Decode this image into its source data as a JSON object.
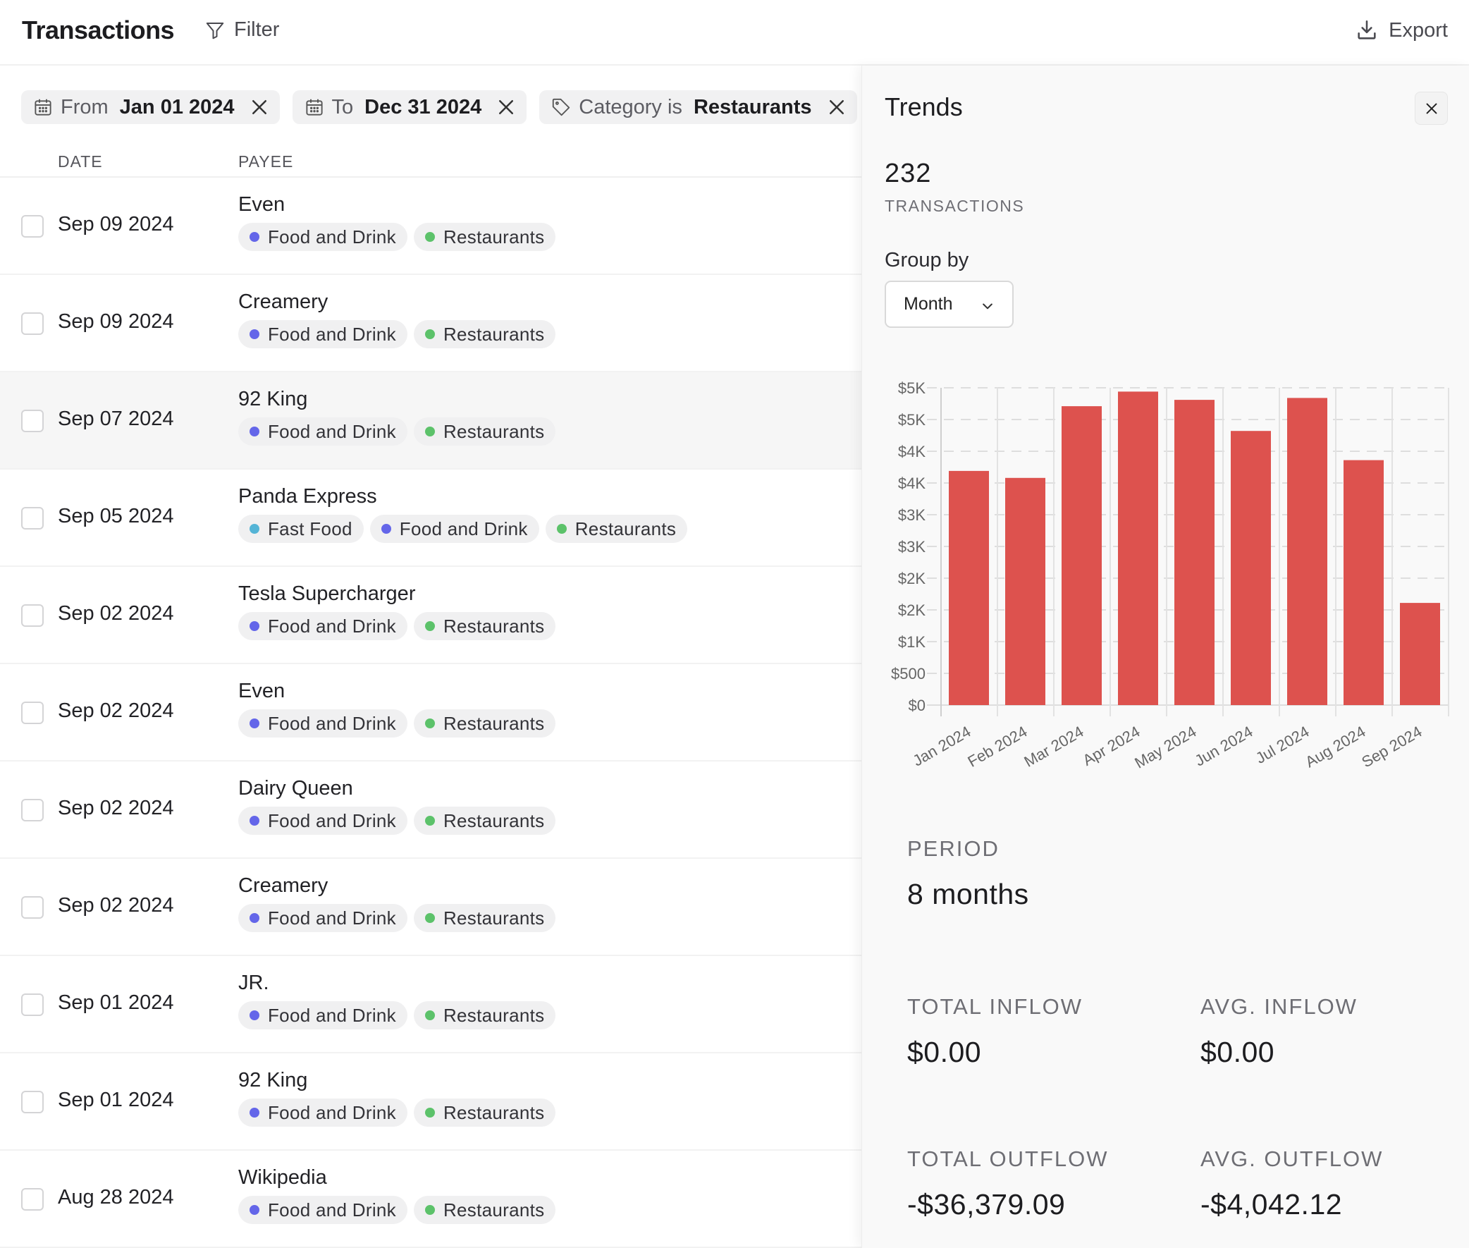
{
  "header": {
    "title": "Transactions",
    "filter_label": "Filter",
    "export_label": "Export"
  },
  "filters": [
    {
      "prefix": "From",
      "value": "Jan 01 2024",
      "icon": "calendar-icon"
    },
    {
      "prefix": "To",
      "value": "Dec 31 2024",
      "icon": "calendar-icon"
    },
    {
      "prefix": "Category is",
      "value": "Restaurants",
      "icon": "tag-icon"
    }
  ],
  "columns": {
    "date": "DATE",
    "payee": "PAYEE"
  },
  "tag_colors": {
    "Food and Drink": "#6466e9",
    "Restaurants": "#5cc26a",
    "Fast Food": "#54b4d6"
  },
  "transactions": [
    {
      "date": "Sep 09 2024",
      "payee": "Even",
      "tags": [
        "Food and Drink",
        "Restaurants"
      ]
    },
    {
      "date": "Sep 09 2024",
      "payee": "Creamery",
      "tags": [
        "Food and Drink",
        "Restaurants"
      ]
    },
    {
      "date": "Sep 07 2024",
      "payee": "92 King",
      "tags": [
        "Food and Drink",
        "Restaurants"
      ],
      "hovered": true
    },
    {
      "date": "Sep 05 2024",
      "payee": "Panda Express",
      "tags": [
        "Fast Food",
        "Food and Drink",
        "Restaurants"
      ]
    },
    {
      "date": "Sep 02 2024",
      "payee": "Tesla Supercharger",
      "tags": [
        "Food and Drink",
        "Restaurants"
      ]
    },
    {
      "date": "Sep 02 2024",
      "payee": "Even",
      "tags": [
        "Food and Drink",
        "Restaurants"
      ]
    },
    {
      "date": "Sep 02 2024",
      "payee": "Dairy Queen",
      "tags": [
        "Food and Drink",
        "Restaurants"
      ]
    },
    {
      "date": "Sep 02 2024",
      "payee": "Creamery",
      "tags": [
        "Food and Drink",
        "Restaurants"
      ]
    },
    {
      "date": "Sep 01 2024",
      "payee": "JR.",
      "tags": [
        "Food and Drink",
        "Restaurants"
      ]
    },
    {
      "date": "Sep 01 2024",
      "payee": "92 King",
      "tags": [
        "Food and Drink",
        "Restaurants"
      ]
    },
    {
      "date": "Aug 28 2024",
      "payee": "Wikipedia",
      "tags": [
        "Food and Drink",
        "Restaurants"
      ]
    }
  ],
  "trends": {
    "title": "Trends",
    "count": "232",
    "count_label": "TRANSACTIONS",
    "group_by_label": "Group by",
    "group_by_value": "Month",
    "period_label": "PERIOD",
    "period_value": "8 months",
    "total_inflow_label": "TOTAL INFLOW",
    "total_inflow_value": "$0.00",
    "avg_inflow_label": "AVG. INFLOW",
    "avg_inflow_value": "$0.00",
    "total_outflow_label": "TOTAL OUTFLOW",
    "total_outflow_value": "-$36,379.09",
    "avg_outflow_label": "AVG. OUTFLOW",
    "avg_outflow_value": "-$4,042.12"
  },
  "chart_data": {
    "type": "bar",
    "title": "",
    "xlabel": "",
    "ylabel": "",
    "categories": [
      "Jan 2024",
      "Feb 2024",
      "Mar 2024",
      "Apr 2024",
      "May 2024",
      "Jun 2024",
      "Jul 2024",
      "Aug 2024",
      "Sep 2024"
    ],
    "values": [
      3690,
      3580,
      4710,
      4940,
      4810,
      4320,
      4840,
      3860,
      1610
    ],
    "ylim": [
      0,
      5000
    ],
    "yticks": [
      0,
      500,
      1000,
      1500,
      2000,
      2500,
      3000,
      3500,
      4000,
      4500,
      5000
    ],
    "ytick_labels": [
      "$0",
      "$500",
      "$1K",
      "$2K",
      "$2K",
      "$3K",
      "$3K",
      "$4K",
      "$4K",
      "$5K",
      "$5K"
    ],
    "bar_color": "#dd524e",
    "grid": true,
    "legend": "none"
  }
}
